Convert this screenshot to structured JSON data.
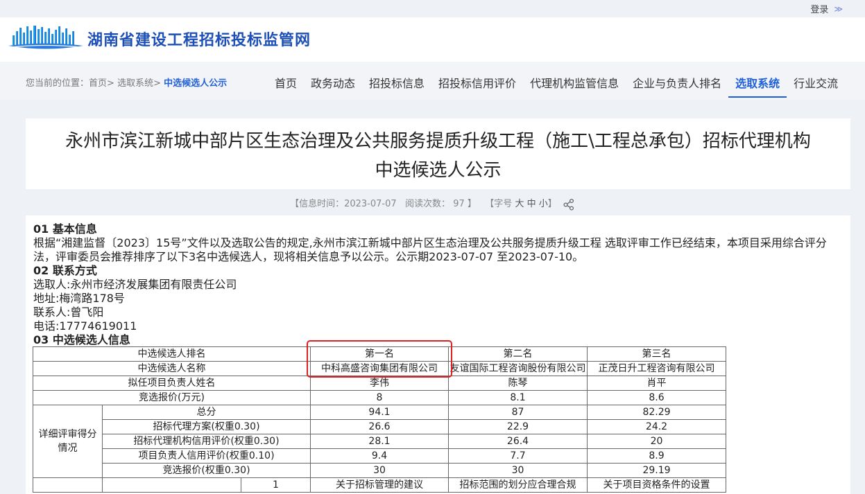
{
  "topbar": {
    "login_label": "登录",
    "login_arrow": "≫"
  },
  "header": {
    "site_title": "湖南省建设工程招标投标监管网"
  },
  "breadcrumb": {
    "prefix": "您当前的位置：",
    "items": [
      "首页>",
      "选取系统>"
    ],
    "current": "中选候选人公示"
  },
  "nav": {
    "items": [
      {
        "label": "首页"
      },
      {
        "label": "政务动态"
      },
      {
        "label": "招投标信息"
      },
      {
        "label": "招投标信用评价"
      },
      {
        "label": "代理机构监管信息"
      },
      {
        "label": "企业与负责人排名"
      },
      {
        "label": "选取系统"
      },
      {
        "label": "行业交流"
      }
    ],
    "active_index": 6
  },
  "article": {
    "title_line1": "永州市滨江新城中部片区生态治理及公共服务提质升级工程（施工\\工程总承包）招标代理机构",
    "title_line2": "中选候选人公示",
    "meta_date": "【信息时间：2023-07-07",
    "meta_reads": "阅读次数：",
    "meta_read_count": "97",
    "meta_reads_end": "】",
    "font_prefix": "【字号",
    "font_large": "大",
    "font_medium": "中",
    "font_small": "小",
    "font_end": "】"
  },
  "sections": {
    "s1_heading": "01 基本信息",
    "s1_text": "根据“湘建监督〔2023〕15号”文件以及选取公告的规定,永州市滨江新城中部片区生态治理及公共服务提质升级工程 选取评审工作已经结束，本项目采用综合评分法，评审委员会推荐排序了以下3名中选候选人，现将相关信息予以公示。公示期2023-07-07 至2023-07-10。",
    "s2_heading": "02 联系方式",
    "s2_lines": [
      "选取人:永州市经济发展集团有限责任公司",
      "地址:梅湾路178号",
      "联系人:曾飞阳",
      "电话:17774619011"
    ],
    "s3_heading": "03 中选候选人信息"
  },
  "table": {
    "rank_label": "中选候选人排名",
    "ranks": [
      "第一名",
      "第二名",
      "第三名"
    ],
    "name_label": "中选候选人名称",
    "names": [
      "中科高盛咨询集团有限公司",
      "友谊国际工程咨询股份有限公司",
      "正茂日升工程咨询有限公司"
    ],
    "leader_label": "拟任项目负责人姓名",
    "leaders": [
      "李伟",
      "陈琴",
      "肖平"
    ],
    "price_label": "竞选报价(万元)",
    "prices": [
      "8",
      "8.1",
      "8.6"
    ],
    "detail_label": "详细评审得分情况",
    "detail_rows": [
      {
        "label": "总分",
        "values": [
          "94.1",
          "87",
          "82.29"
        ]
      },
      {
        "label": "招标代理方案(权重0.30)",
        "values": [
          "26.6",
          "22.9",
          "24.2"
        ]
      },
      {
        "label": "招标代理机构信用评价(权重0.30)",
        "values": [
          "28.1",
          "26.4",
          "20"
        ]
      },
      {
        "label": "项目负责人信用评价(权重0.10)",
        "values": [
          "9.4",
          "7.7",
          "8.9"
        ]
      },
      {
        "label": "竞选报价(权重0.30)",
        "values": [
          "30",
          "30",
          "29.19"
        ]
      }
    ],
    "advice_row": {
      "index": "1",
      "values": [
        "关于招标管理的建议",
        "招标范围的划分应合理合规",
        "关于项目资格条件的设置"
      ]
    }
  },
  "colors": {
    "brand_blue": "#1d4fb8",
    "active_blue": "#1d5fd8",
    "highlight_red": "#e02020"
  }
}
